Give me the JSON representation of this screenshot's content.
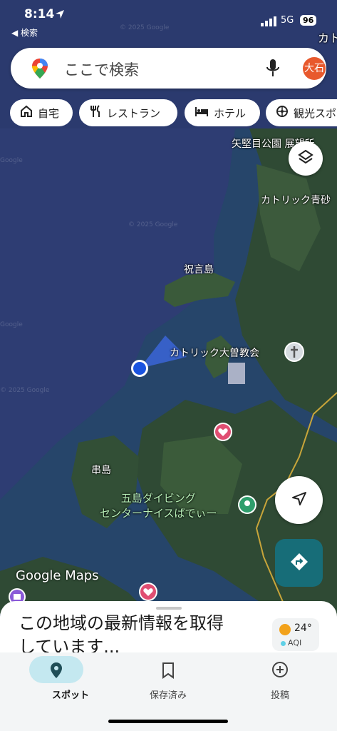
{
  "status": {
    "time": "8:14",
    "back_label": "◀ 検索",
    "network": "5G",
    "battery": "96"
  },
  "search": {
    "placeholder": "ここで検索",
    "avatar_text": "大石"
  },
  "chips": [
    {
      "label": "自宅",
      "icon": "home-icon"
    },
    {
      "label": "レストラン",
      "icon": "restaurant-icon"
    },
    {
      "label": "ホテル",
      "icon": "hotel-icon"
    },
    {
      "label": "観光スポ",
      "icon": "attraction-icon"
    }
  ],
  "map_labels": {
    "yatakame": "矢堅目公園 展望所",
    "catholic_aoka": "カトリック青砂",
    "shugonjima": "祝言島",
    "catholic_oso": "カトリック大曽教会",
    "kushijima": "串島",
    "goto_diving": "五島ダイビング\nセンターナイスばでぃー",
    "edge_top": "カト",
    "google_maps": "Google Maps",
    "watermark": "© 2025 Google",
    "watermark_google": "Google"
  },
  "sheet": {
    "text": "この地域の最新情報を取得しています...",
    "temperature": "24°",
    "aqi": "AQI"
  },
  "nav": [
    {
      "label": "スポット",
      "icon": "pin-icon",
      "active": true
    },
    {
      "label": "保存済み",
      "icon": "bookmark-icon",
      "active": false
    },
    {
      "label": "投稿",
      "icon": "plus-circle-icon",
      "active": false
    }
  ],
  "colors": {
    "water": "#2b3a6e",
    "land": "#33503a",
    "accent": "#176d78",
    "avatar": "#e8592d"
  }
}
